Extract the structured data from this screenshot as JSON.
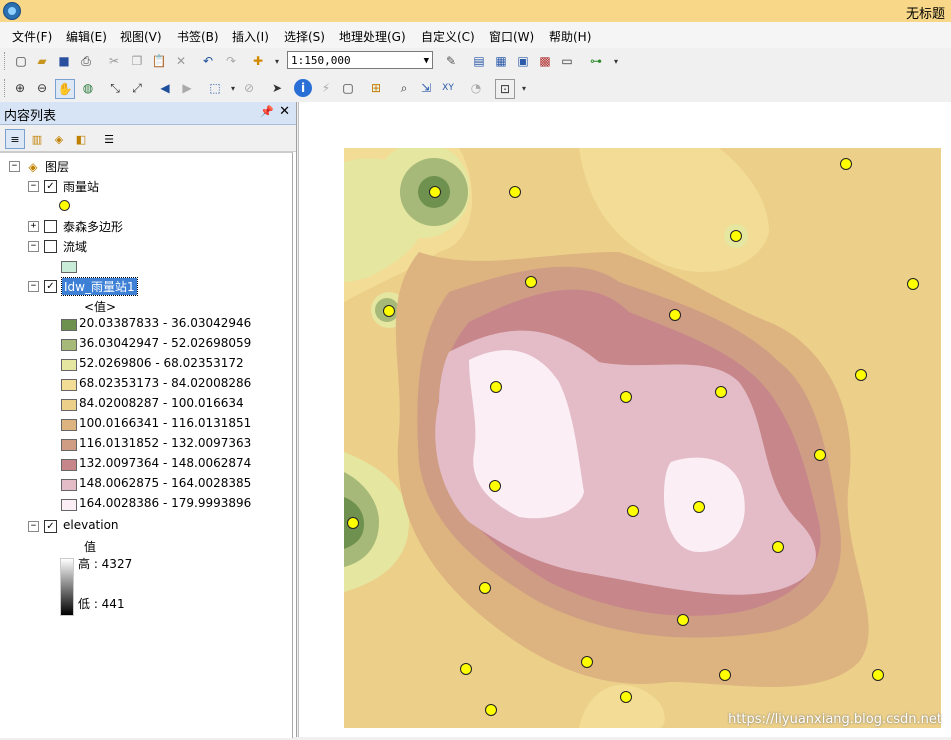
{
  "window": {
    "title": "无标题"
  },
  "menu": [
    "文件(F)",
    "编辑(E)",
    "视图(V)",
    "书签(B)",
    "插入(I)",
    "选择(S)",
    "地理处理(G)",
    "自定义(C)",
    "窗口(W)",
    "帮助(H)"
  ],
  "toolbar": {
    "scale": "1:150,000"
  },
  "toc": {
    "title": "内容列表",
    "root": "图层",
    "layers": {
      "rain": "雨量站",
      "thiessen": "泰森多边形",
      "basin": "流域",
      "idw": "Idw_雨量站1",
      "idw_value_header": "<值>",
      "idw_classes": [
        {
          "label": "20.03387833 - 36.03042946",
          "color": "#6f9150"
        },
        {
          "label": "36.03042947 - 52.02698059",
          "color": "#a6b978"
        },
        {
          "label": "52.0269806 - 68.02353172",
          "color": "#e5e6a0"
        },
        {
          "label": "68.02353173 - 84.02008286",
          "color": "#f2dc96"
        },
        {
          "label": "84.02008287 - 100.016634",
          "color": "#ecd08a"
        },
        {
          "label": "100.0166341 - 116.0131851",
          "color": "#ddb480"
        },
        {
          "label": "116.0131852 - 132.0097363",
          "color": "#cf9d84"
        },
        {
          "label": "132.0097364 - 148.0062874",
          "color": "#c7878a"
        },
        {
          "label": "148.0062875 - 164.0028385",
          "color": "#e3bcc8"
        },
        {
          "label": "164.0028386 - 179.9993896",
          "color": "#fbeef4"
        }
      ],
      "elevation": "elevation",
      "elev_value_header": "值",
      "elev_high": "高 : 4327",
      "elev_low": "低 : 441"
    }
  },
  "map": {
    "watermark": "https://liyuanxiang.blog.csdn.net"
  },
  "colors": {
    "title_bg": "#f8d888",
    "toc_header": "#d6e4f5",
    "station": "#ffff00"
  }
}
